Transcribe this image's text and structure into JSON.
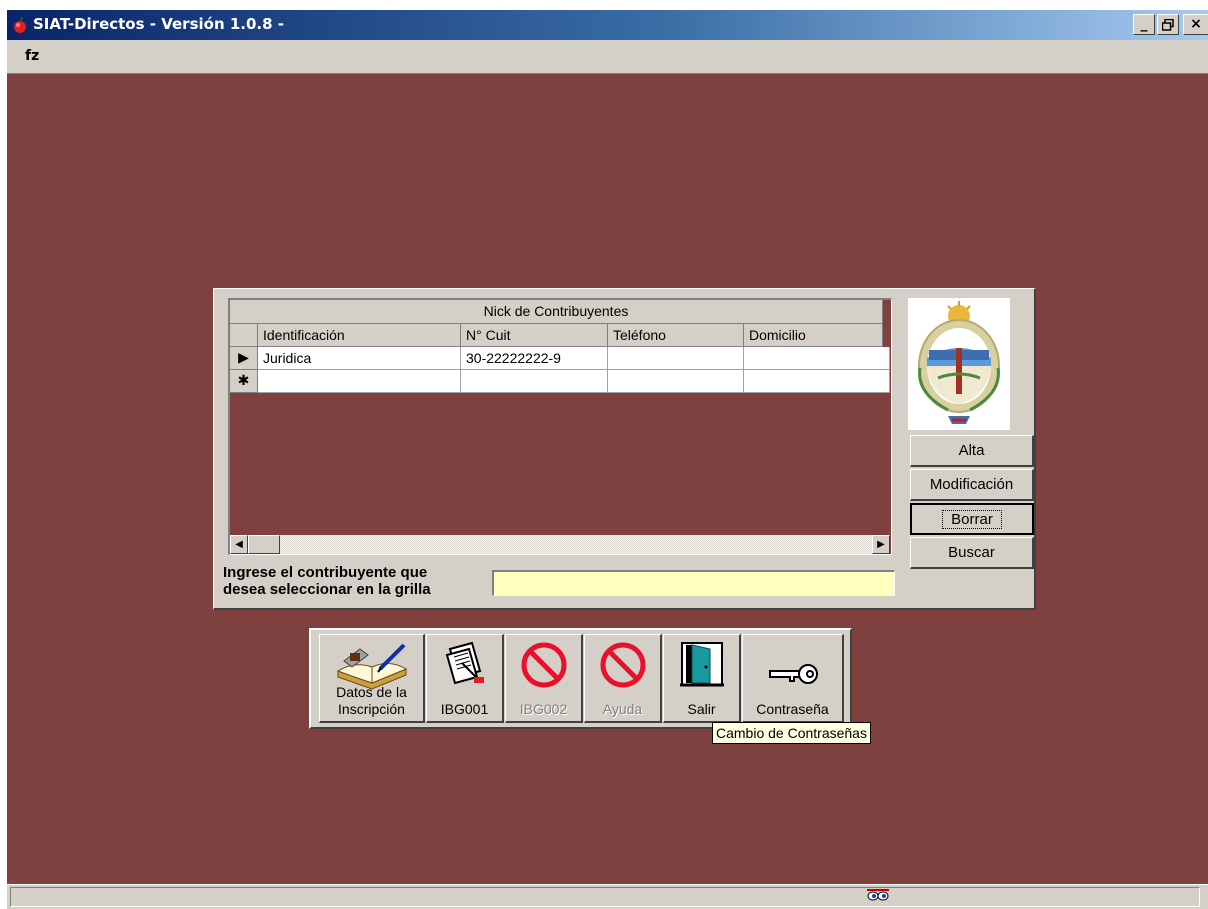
{
  "window": {
    "title": "SIAT-Directos - Versión 1.0.8 -",
    "controls": {
      "minimize": "_",
      "maximize": "▫",
      "close": "×"
    }
  },
  "menu": {
    "items": [
      {
        "label": "fz"
      }
    ]
  },
  "grid": {
    "caption": "Nick de Contribuyentes",
    "columns": [
      "Identificación",
      "N° Cuit",
      "Teléfono",
      "Domicilio"
    ],
    "rows": [
      {
        "indicator": "▶",
        "cells": [
          "Juridica",
          "30-22222222-9",
          "",
          ""
        ]
      },
      {
        "indicator": "✱",
        "cells": [
          "",
          "",
          "",
          ""
        ]
      }
    ]
  },
  "side_buttons": {
    "alta": "Alta",
    "modificacion": "Modificación",
    "borrar": "Borrar",
    "buscar": "Buscar"
  },
  "search": {
    "label_line1": "Ingrese el contribuyente que",
    "label_line2": "desea seleccionar en la grilla",
    "value": ""
  },
  "toolbar": {
    "datos_line1": "Datos de la",
    "datos_line2": "Inscripción",
    "ibg001": "IBG001",
    "ibg002": "IBG002",
    "ayuda": "Ayuda",
    "salir": "Salir",
    "contrasena": "Contraseña"
  },
  "tooltip": "Cambio de Contraseñas",
  "colors": {
    "desktop": "#7f4040",
    "face": "#d4d0c8",
    "input_bg": "#ffffc0",
    "title_start": "#0a246a",
    "title_end": "#a6caf0"
  },
  "icons": [
    "app-icon",
    "book-pen-icon",
    "document-icon",
    "forbidden-icon",
    "door-icon",
    "key-icon",
    "eyes-icon",
    "coat-of-arms-icon"
  ]
}
